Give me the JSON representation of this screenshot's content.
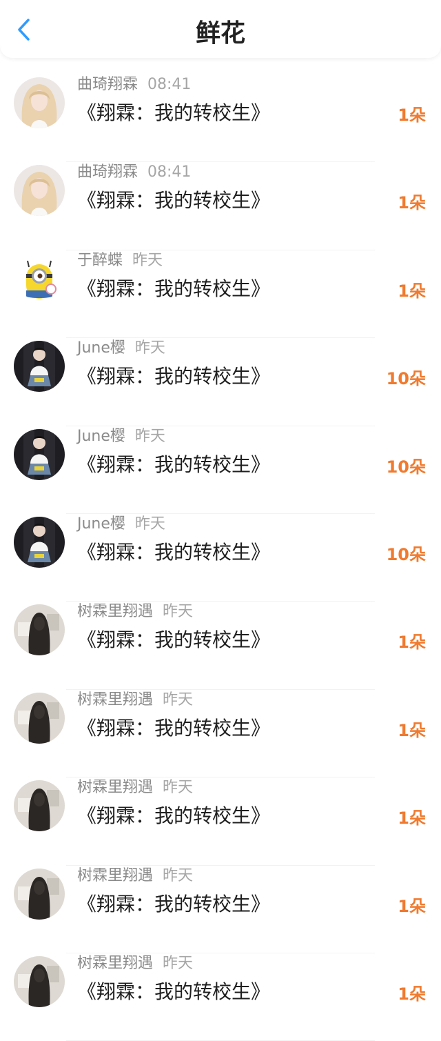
{
  "header": {
    "title": "鲜花",
    "back_icon": "chevron-left-icon",
    "accent": "#2f9bff"
  },
  "colors": {
    "amount": "#f07a2e"
  },
  "items": [
    {
      "user": "曲琦翔霖",
      "time": "08:41",
      "work": "《翔霖：我的转校生》",
      "amount": "1朵",
      "avatar": "blonde-girl-avatar"
    },
    {
      "user": "曲琦翔霖",
      "time": "08:41",
      "work": "《翔霖：我的转校生》",
      "amount": "1朵",
      "avatar": "blonde-girl-avatar"
    },
    {
      "user": "于醉蝶",
      "time": "昨天",
      "work": "《翔霖：我的转校生》",
      "amount": "1朵",
      "avatar": "minion-avatar"
    },
    {
      "user": "June樱",
      "time": "昨天",
      "work": "《翔霖：我的转校生》",
      "amount": "10朵",
      "avatar": "boy-sitting-avatar"
    },
    {
      "user": "June樱",
      "time": "昨天",
      "work": "《翔霖：我的转校生》",
      "amount": "10朵",
      "avatar": "boy-sitting-avatar"
    },
    {
      "user": "June樱",
      "time": "昨天",
      "work": "《翔霖：我的转校生》",
      "amount": "10朵",
      "avatar": "boy-sitting-avatar"
    },
    {
      "user": "树霖里翔遇",
      "time": "昨天",
      "work": "《翔霖：我的转校生》",
      "amount": "1朵",
      "avatar": "hooded-figure-avatar"
    },
    {
      "user": "树霖里翔遇",
      "time": "昨天",
      "work": "《翔霖：我的转校生》",
      "amount": "1朵",
      "avatar": "hooded-figure-avatar"
    },
    {
      "user": "树霖里翔遇",
      "time": "昨天",
      "work": "《翔霖：我的转校生》",
      "amount": "1朵",
      "avatar": "hooded-figure-avatar"
    },
    {
      "user": "树霖里翔遇",
      "time": "昨天",
      "work": "《翔霖：我的转校生》",
      "amount": "1朵",
      "avatar": "hooded-figure-avatar"
    },
    {
      "user": "树霖里翔遇",
      "time": "昨天",
      "work": "《翔霖：我的转校生》",
      "amount": "1朵",
      "avatar": "hooded-figure-avatar"
    }
  ]
}
